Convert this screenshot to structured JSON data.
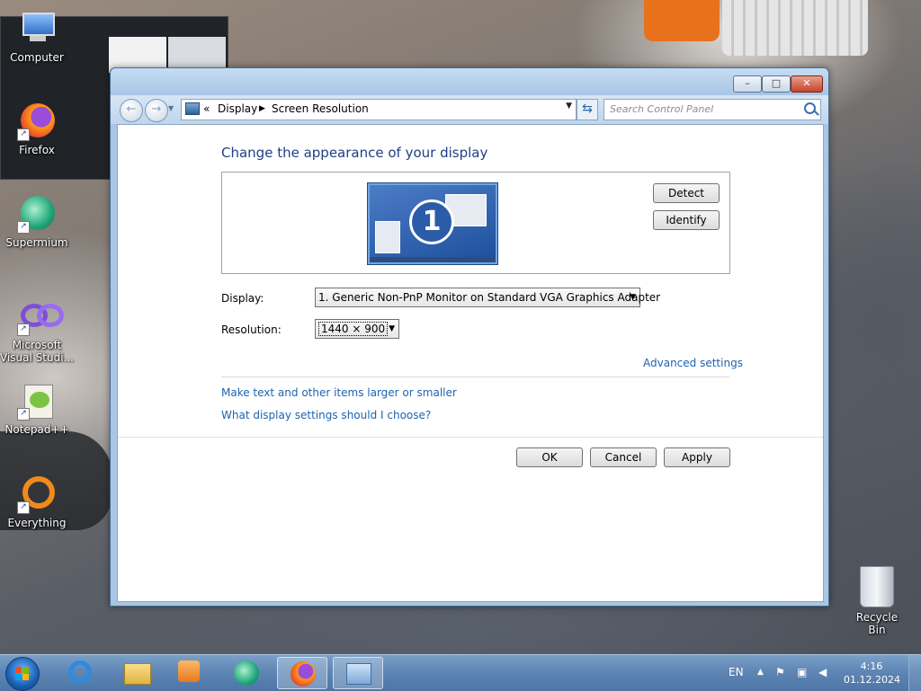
{
  "desktop": {
    "icons": [
      {
        "label": "Computer"
      },
      {
        "label": "Firefox"
      },
      {
        "label": "Supermium"
      },
      {
        "label": "Microsoft Visual Studi..."
      },
      {
        "label": "Notepad++"
      },
      {
        "label": "Everything"
      }
    ],
    "recycle_bin_label": "Recycle Bin"
  },
  "window": {
    "controls": {
      "minimize": "–",
      "maximize": "□",
      "close": "✕"
    },
    "breadcrumb": [
      "Display",
      "Screen Resolution"
    ],
    "breadcrumb_prefix": "«",
    "search_placeholder": "Search Control Panel",
    "heading": "Change the appearance of your display",
    "monitor_number": "1",
    "detect_label": "Detect",
    "identify_label": "Identify",
    "display_label": "Display:",
    "display_value": "1. Generic Non-PnP Monitor on Standard VGA Graphics Adapter",
    "resolution_label": "Resolution:",
    "resolution_value": "1440 × 900",
    "advanced_link": "Advanced settings",
    "links": [
      "Make text and other items larger or smaller",
      "What display settings should I choose?"
    ],
    "ok_label": "OK",
    "cancel_label": "Cancel",
    "apply_label": "Apply"
  },
  "taskbar": {
    "language": "EN",
    "time": "4:16",
    "date": "01.12.2024",
    "pinned": [
      "internet-explorer-icon",
      "explorer-folder-icon",
      "media-player-icon",
      "supermium-icon",
      "firefox-icon",
      "control-panel-icon"
    ]
  },
  "colors": {
    "heading": "#1e3f86",
    "link": "#1c64b0",
    "taskbar": "#5f86b4"
  }
}
